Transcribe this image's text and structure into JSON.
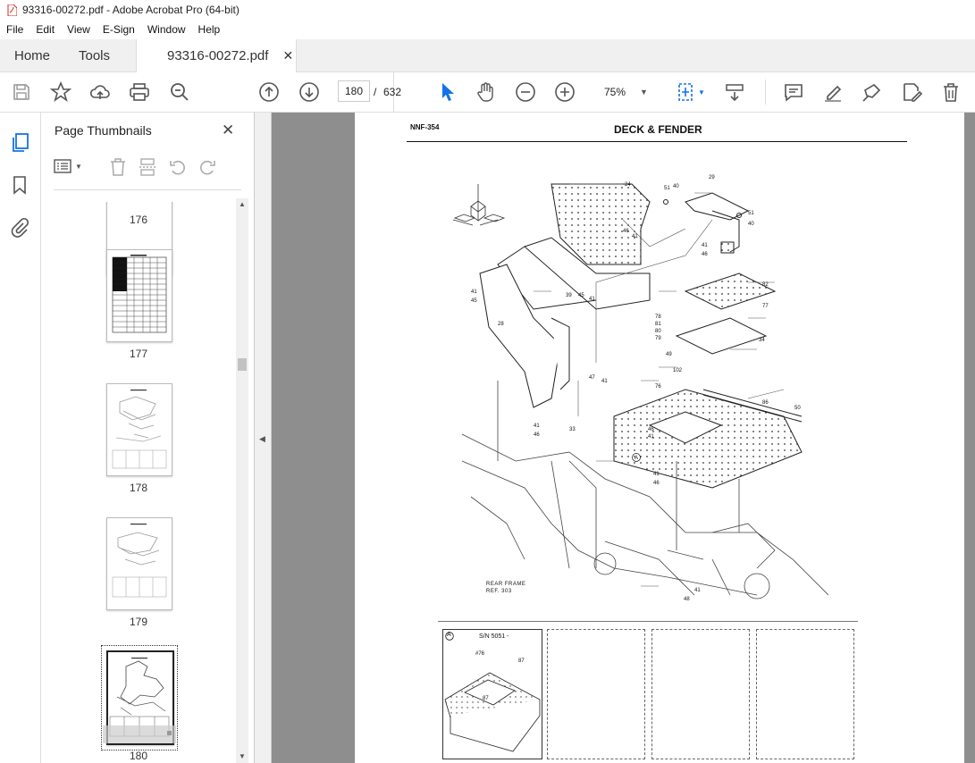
{
  "window": {
    "title": "93316-00272.pdf - Adobe Acrobat Pro (64-bit)"
  },
  "menu": [
    "File",
    "Edit",
    "View",
    "E-Sign",
    "Window",
    "Help"
  ],
  "tabs": {
    "home": "Home",
    "tools": "Tools",
    "document": "93316-00272.pdf"
  },
  "toolbar": {
    "page_current": "180",
    "page_separator": "/",
    "page_total": "632",
    "zoom": "75%"
  },
  "sidebar": {
    "title": "Page Thumbnails",
    "thumbnails": [
      {
        "label": "176"
      },
      {
        "label": "177"
      },
      {
        "label": "178"
      },
      {
        "label": "179"
      },
      {
        "label": "180",
        "selected": true
      }
    ]
  },
  "document": {
    "code": "NNF-354",
    "title": "DECK & FENDER",
    "callouts": [
      "24",
      "29",
      "51",
      "40",
      "46",
      "41",
      "82",
      "77",
      "28",
      "39",
      "45",
      "78",
      "81",
      "80",
      "79",
      "34",
      "49",
      "102",
      "76",
      "47",
      "33",
      "86",
      "50",
      "48"
    ],
    "frame_note_1": "REAR FRAME",
    "frame_note_2": "REF. 303",
    "inset_label": "S/N 5051 -",
    "inset_marker": "A",
    "inset_callouts": [
      "#76",
      "87",
      "87"
    ]
  },
  "colors": {
    "accent": "#1473e6",
    "pdf_red": "#d9241c",
    "viewer_bg": "#8e8e8e"
  }
}
